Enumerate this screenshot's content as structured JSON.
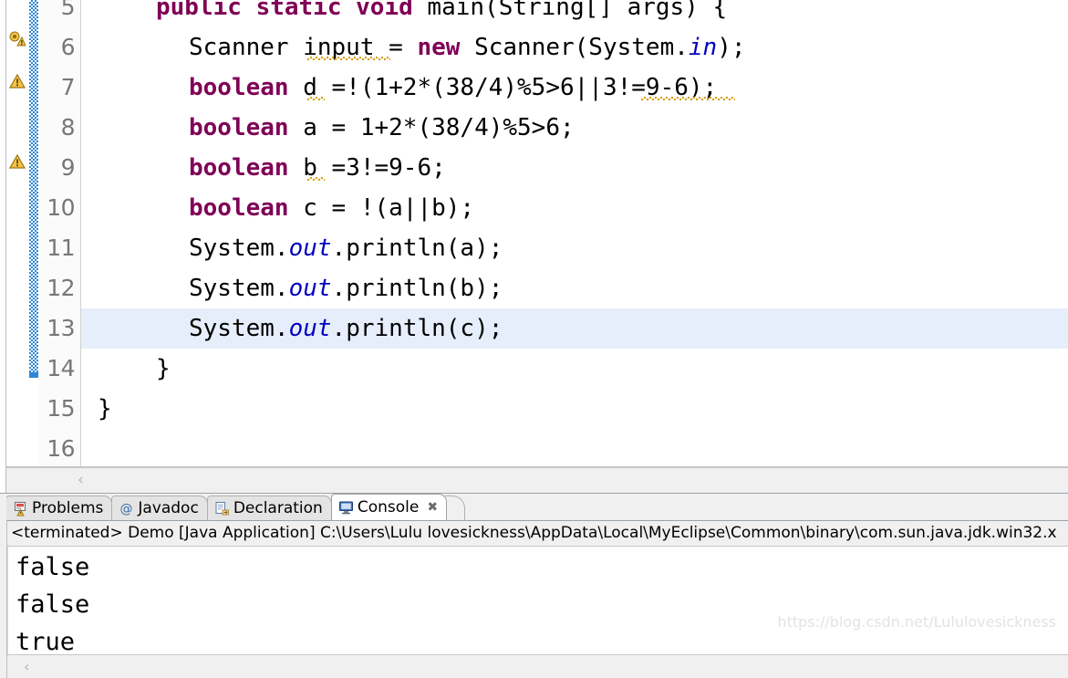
{
  "editor": {
    "first_visible_line": 5,
    "highlighted_line": 13,
    "lines": [
      {
        "number": "5",
        "indent": 2,
        "code": "public static void main(String[] args) {"
      },
      {
        "number": "6",
        "indent": 3,
        "code": "Scanner input = new Scanner(System.in);"
      },
      {
        "number": "7",
        "indent": 3,
        "code": "boolean d =!(1+2*(38/4)%5>6||3!=9-6);"
      },
      {
        "number": "8",
        "indent": 3,
        "code": "boolean a = 1+2*(38/4)%5>6;"
      },
      {
        "number": "9",
        "indent": 3,
        "code": "boolean b =3!=9-6;"
      },
      {
        "number": "10",
        "indent": 3,
        "code": "boolean c = !(a||b);"
      },
      {
        "number": "11",
        "indent": 3,
        "code": "System.out.println(a);"
      },
      {
        "number": "12",
        "indent": 3,
        "code": "System.out.println(b);"
      },
      {
        "number": "13",
        "indent": 3,
        "code": "System.out.println(c);"
      },
      {
        "number": "14",
        "indent": 2,
        "code": "}"
      },
      {
        "number": "15",
        "indent": 1,
        "code": "}"
      },
      {
        "number": "16",
        "indent": 0,
        "code": ""
      }
    ],
    "markers": [
      {
        "line": "6",
        "icon": "warning-quickfix-icon",
        "tooltip": "warning"
      },
      {
        "line": "7",
        "icon": "warning-icon",
        "tooltip": "warning"
      },
      {
        "line": "9",
        "icon": "warning-icon",
        "tooltip": "warning"
      }
    ],
    "fold_marker": {
      "line": "5",
      "icon": "fold-collapse-icon"
    },
    "scroll_arrow": "‹",
    "colors": {
      "keyword": "#7f0055",
      "field": "#0000c0",
      "text": "#000000",
      "line_highlight": "#e6eefb",
      "change_stripe": "#2e86d8",
      "line_number": "#777777"
    }
  },
  "panel": {
    "tabs": [
      {
        "label": "Problems",
        "icon": "problems-icon",
        "active": false,
        "closable": false
      },
      {
        "label": "Javadoc",
        "icon": "javadoc-at-icon",
        "active": false,
        "closable": false
      },
      {
        "label": "Declaration",
        "icon": "declaration-icon",
        "active": false,
        "closable": false
      },
      {
        "label": "Console",
        "icon": "console-icon",
        "active": true,
        "closable": true
      }
    ],
    "close_glyph": "✖",
    "status_line": "<terminated> Demo [Java Application] C:\\Users\\Lulu lovesickness\\AppData\\Local\\MyEclipse\\Common\\binary\\com.sun.java.jdk.win32.x",
    "output_lines": [
      "false",
      "false",
      "true"
    ],
    "scroll_arrow": "‹"
  },
  "watermark": "https://blog.csdn.net/Lululovesickness"
}
